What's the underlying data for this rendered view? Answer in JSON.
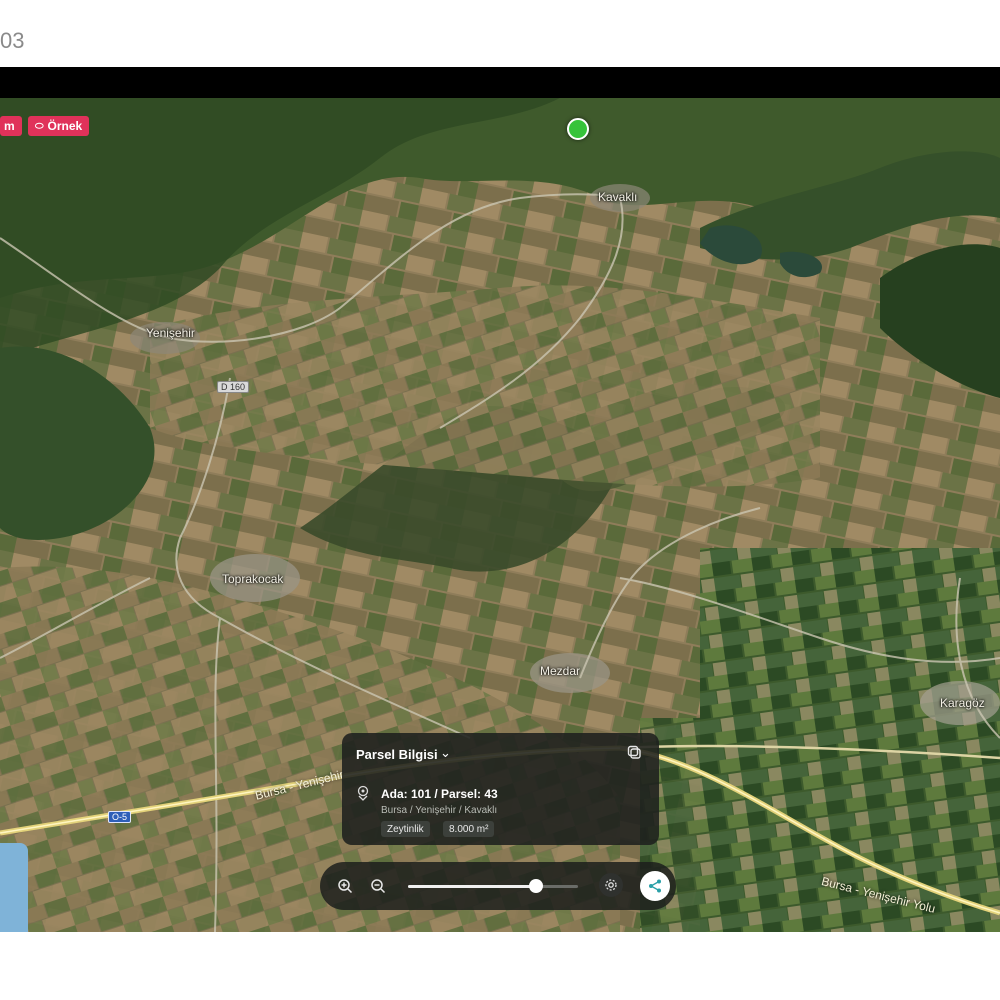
{
  "page_number": "03",
  "chips": [
    {
      "label": "m"
    },
    {
      "label": "Örnek",
      "icon": "tag-icon"
    }
  ],
  "places": {
    "kavakli": "Kavaklı",
    "yenisehir": "Yenişehir",
    "toprakocak": "Toprakocak",
    "mezdar": "Mezdar",
    "karagoz": "Karagöz"
  },
  "road_badges": {
    "d160": "D 160",
    "orhan": "O-5"
  },
  "road_names": {
    "bursa_left": "Bursa - Yenişehir",
    "bursa_right": "Bursa - Yenişehir Yolu"
  },
  "info_card": {
    "title": "Parsel Bilgisi",
    "parcel": "Ada: 101 / Parsel: 43",
    "address": "Bursa / Yenişehir / Kavaklı",
    "tags": [
      "Zeytinlik",
      "8.000 m²"
    ]
  },
  "toolbar": {
    "zoom_level": 0.75
  },
  "colors": {
    "accent_red": "#e0325a",
    "pin_green": "#36c33a",
    "card_bg": "#1e201e"
  }
}
